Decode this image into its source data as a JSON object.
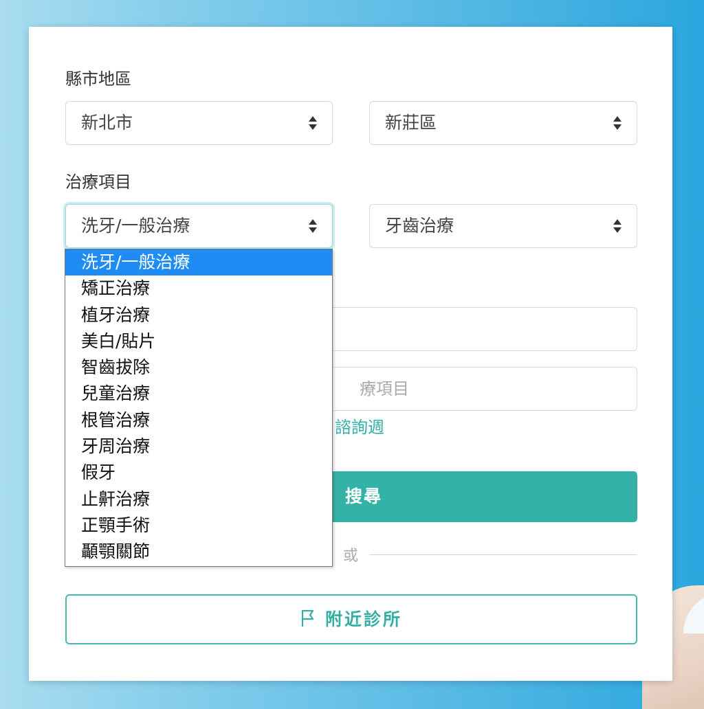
{
  "region": {
    "label": "縣市地區",
    "city": "新北市",
    "district": "新莊區"
  },
  "treatment": {
    "label": "治療項目",
    "selected": "洗牙/一般治療",
    "category": "牙齒治療",
    "options": [
      "洗牙/一般治療",
      "矯正治療",
      "植牙治療",
      "美白/貼片",
      "智齒拔除",
      "兒童治療",
      "根管治療",
      "牙周治療",
      "假牙",
      "止鼾治療",
      "正顎手術",
      "顳顎關節"
    ]
  },
  "fields": {
    "input1_value": "",
    "input2_partial_placeholder": "療項目"
  },
  "hint_partial": "諮詢週",
  "search_button_partial": "、搜尋",
  "or_text": "或",
  "nearby_button": "附近診所",
  "colors": {
    "accent": "#35b2a7",
    "selected_option": "#1f8cf3"
  }
}
